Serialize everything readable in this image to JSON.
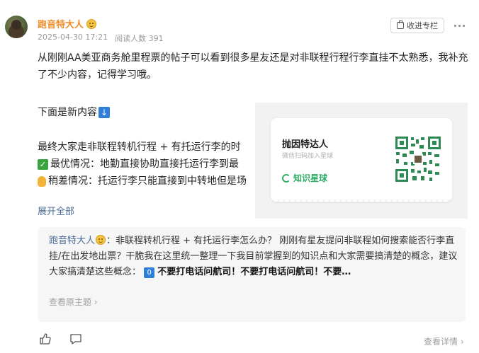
{
  "post": {
    "author": "跑音特大人",
    "date": "2025-04-30 17:21",
    "read_count": "阅读人数 391",
    "favorite_label": "收进专栏",
    "para1": "从刚刚AA美亚商务舱里程票的帖子可以看到很多星友还是对非联程行程行李直挂不太熟悉，我补充了不少内容，记得学习哦。",
    "para2": "下面是新内容",
    "para3": "最终大家走非联程转机行程 + 有托运行李的时",
    "para4": "最优情况：地勤直接协助直接托运行李到最",
    "para5": "稍差情况：托运行李只能直接到中转地但是场",
    "expand_label": "展开全部"
  },
  "card": {
    "title": "抛因特达人",
    "subtitle": "微信扫码加入星球",
    "brand": "知识星球"
  },
  "quote": {
    "author": "跑音特大人",
    "text": "：非联程转机行程 + 有托运行李怎么办？ 刚刚有星友提问非联程如何搜索能否行李直挂/在出发地出票？干脆我在这里统一整理一下我目前掌握到的知识点和大家需要搞清楚的概念，建议大家搞清楚这些概念：",
    "number": "0",
    "warning": "不要打电话问航司！不要打电话问航司！不要…",
    "view_original": "查看原主题"
  },
  "footer": {
    "details_label": "查看详情"
  },
  "colors": {
    "author": "#f08c28",
    "link": "#4a6c96",
    "brand_green": "#2fab66",
    "arrow_blue": "#2f7fd8"
  }
}
